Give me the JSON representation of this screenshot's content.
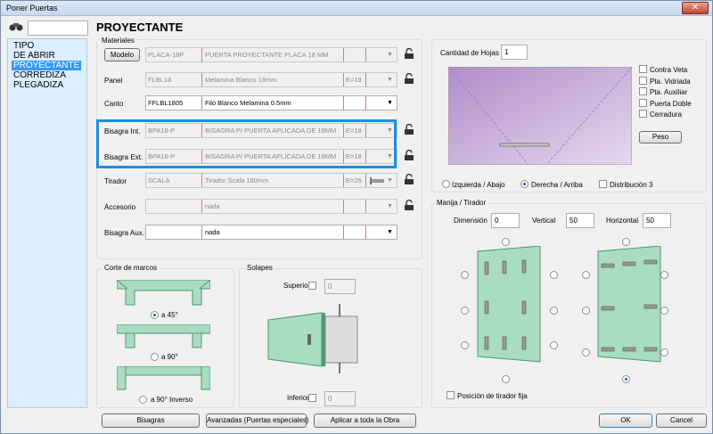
{
  "window": {
    "title": "Poner Puertas",
    "close": "✕"
  },
  "nav": {
    "items": [
      "TIPO",
      "DE ABRIR",
      "PROYECTANTE",
      "CORREDIZA",
      "PLEGADIZA"
    ],
    "selected": "PROYECTANTE"
  },
  "header": {
    "title": "PROYECTANTE"
  },
  "materiales": {
    "title": "Materiales",
    "modelo_btn": "Modelo",
    "rows": [
      {
        "label": "",
        "codigo": "PLACA-18P",
        "descripcion": "PUERTA PROYECTANTE PLACA 18 MM",
        "espesor": "",
        "active": false
      },
      {
        "label": "Panel",
        "codigo": "FLBL18",
        "descripcion": "Melamina Blanco 18mm",
        "espesor": "E=18",
        "active": false
      },
      {
        "label": "Canto",
        "codigo": "FFLBL1805",
        "descripcion": "Filo Blanco Melamina 0.5mm",
        "espesor": "",
        "active": true
      },
      {
        "label": "Bisagra Int.",
        "codigo": "BPA18-P",
        "descripcion": "BISAGRA P/ PUERTA APLICADA DE 18MM",
        "espesor": "E=18",
        "active": false
      },
      {
        "label": "Bisagra Ext.",
        "codigo": "BPA18-P",
        "descripcion": "BISAGRA P/ PUERTA APLICADA DE 18MM",
        "espesor": "E=18",
        "active": false
      },
      {
        "label": "Tirador",
        "codigo": "SCALA",
        "descripcion": "Tirador Scala 180mm",
        "espesor": "E=25",
        "active": false
      },
      {
        "label": "Accesorio",
        "codigo": "",
        "descripcion": "nada",
        "espesor": "",
        "active": false
      },
      {
        "label": "Bisagra Aux.",
        "codigo": "",
        "descripcion": "nada",
        "espesor": "",
        "active": true
      }
    ]
  },
  "corte": {
    "title": "Corte de marcos",
    "options": [
      "a 45°",
      "a 90°",
      "a 90° Inverso"
    ],
    "selected": 0
  },
  "solapes": {
    "title": "Solapes",
    "superior_label": "Superior",
    "superior_value": "0",
    "inferior_label": "Inferior",
    "inferior_value": "0"
  },
  "hojas": {
    "label": "Cantidad de Hojas",
    "value": "1"
  },
  "checks": [
    {
      "label": "Contra Veta",
      "checked": false
    },
    {
      "label": "Pta. Vidriada",
      "checked": false
    },
    {
      "label": "Pta. Auxiliar",
      "checked": false
    },
    {
      "label": "Puerta Doble",
      "checked": false
    },
    {
      "label": "Cerradura",
      "checked": false
    }
  ],
  "peso_btn": "Peso",
  "apertura": {
    "options": [
      "Izquierda / Abajo",
      "Derecha / Arriba"
    ],
    "selected": 1,
    "distribucion": "Distribución 3"
  },
  "manija": {
    "title": "Manija / Tirador",
    "dimension_label": "Dimensión",
    "dimension": "0",
    "vertical_label": "Vertical",
    "vertical": "50",
    "horizontal_label": "Horizontal",
    "horizontal": "50",
    "fija": "Posición de tirador fija"
  },
  "footer": {
    "bisagras": "Bisagras",
    "avanzadas": "Avanzadas (Puertas especiales)",
    "aplicar": "Aplicar a toda la Obra",
    "ok": "OK",
    "cancel": "Cancel"
  },
  "colors": {
    "highlight": "#1a8fe0",
    "door": "#c9aed6",
    "panel_green": "#a9dcc0",
    "list_bg": "#ddeeff",
    "selected": "#3399ff"
  }
}
